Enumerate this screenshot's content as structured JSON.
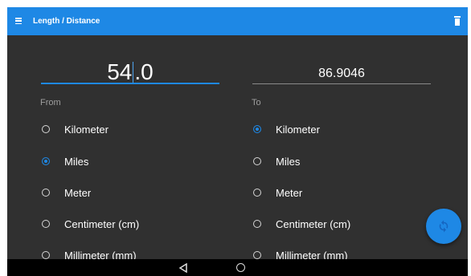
{
  "appbar": {
    "title": "Length / Distance",
    "menu_icon": "hamburger-menu-icon",
    "action_icon": "trash-icon"
  },
  "converter": {
    "from_value_int": "54",
    "from_value_frac": ".0",
    "to_value": "86.9046",
    "from_label": "From",
    "to_label": "To"
  },
  "from_units": [
    {
      "label": "Kilometer",
      "selected": false
    },
    {
      "label": "Miles",
      "selected": true
    },
    {
      "label": "Meter",
      "selected": false
    },
    {
      "label": "Centimeter (cm)",
      "selected": false
    },
    {
      "label": "Millimeter (mm)",
      "selected": false
    }
  ],
  "to_units": [
    {
      "label": "Kilometer",
      "selected": true
    },
    {
      "label": "Miles",
      "selected": false
    },
    {
      "label": "Meter",
      "selected": false
    },
    {
      "label": "Centimeter (cm)",
      "selected": false
    },
    {
      "label": "Millimeter (mm)",
      "selected": false
    }
  ],
  "fab": {
    "icon": "swap-icon"
  },
  "navbar": {
    "back_icon": "back-triangle-icon",
    "home_icon": "home-circle-icon"
  },
  "colors": {
    "accent": "#1e88e5",
    "background": "#303030",
    "navbar": "#000000"
  }
}
